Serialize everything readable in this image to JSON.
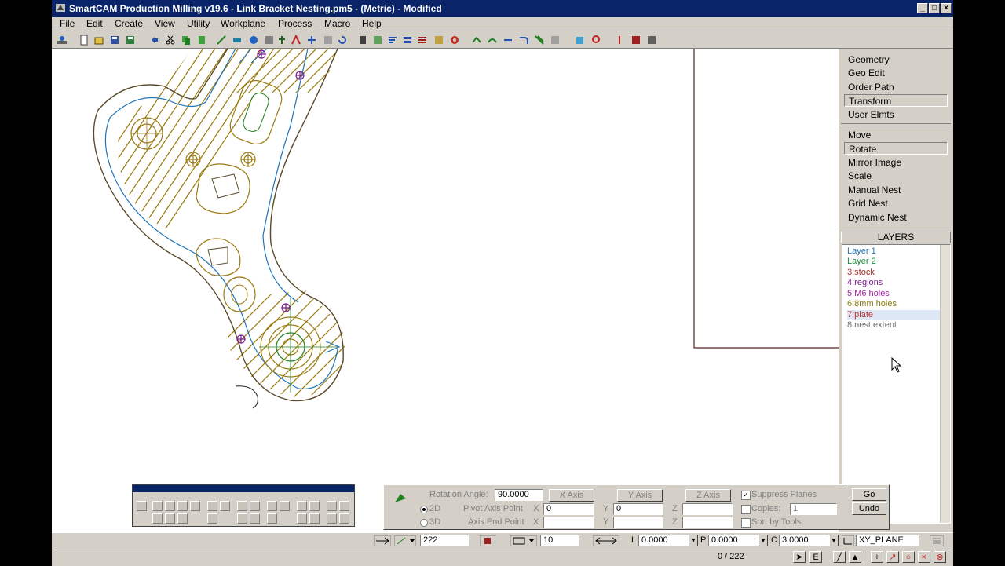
{
  "window": {
    "title": "SmartCAM Production Milling v19.6 - Link Bracket Nesting.pm5 - (Metric) - Modified",
    "controls": {
      "minimize": "_",
      "maximize": "□",
      "close": "×"
    }
  },
  "menu": [
    "File",
    "Edit",
    "Create",
    "View",
    "Utility",
    "Workplane",
    "Process",
    "Macro",
    "Help"
  ],
  "function_menu": {
    "groups": [
      [
        "Geometry",
        "Geo Edit",
        "Order Path",
        "Transform",
        "User Elmts"
      ],
      [
        "Move",
        "Rotate",
        "Mirror Image",
        "Scale",
        "Manual Nest",
        "Grid Nest",
        "Dynamic Nest"
      ]
    ],
    "selected_group_item": "Transform",
    "selected_sub_item": "Rotate"
  },
  "layers": {
    "header": "LAYERS",
    "items": [
      {
        "label": "Layer    1",
        "color": "#1f74b8"
      },
      {
        "label": "Layer    2",
        "color": "#1e8a3c"
      },
      {
        "label": "3:stock",
        "color": "#a0302a"
      },
      {
        "label": "4:regions",
        "color": "#7a1e8c"
      },
      {
        "label": "5:M6 holes",
        "color": "#a020a0"
      },
      {
        "label": "6:8mm holes",
        "color": "#8a7a10"
      },
      {
        "label": "7:plate",
        "color": "#c03030"
      },
      {
        "label": "8:nest extent",
        "color": "#707070"
      }
    ],
    "selected": "7:plate"
  },
  "rotate_panel": {
    "rotation_angle_label": "Rotation Angle:",
    "rotation_angle": "90.0000",
    "x_axis": "X Axis",
    "y_axis": "Y Axis",
    "z_axis": "Z Axis",
    "suppress_planes": "Suppress Planes",
    "suppress_planes_checked": true,
    "go": "Go",
    "undo": "Undo",
    "mode_2d": "2D",
    "mode_3d": "3D",
    "mode_selected": "2D",
    "pivot_label": "Pivot Axis Point",
    "end_label": "Axis End Point",
    "x": "X",
    "y": "Y",
    "z": "Z",
    "pivot_x": "0",
    "pivot_y": "0",
    "copies_label": "Copies:",
    "copies": "1",
    "sort_by_tools": "Sort by Tools"
  },
  "status": {
    "element_number": "222",
    "step_value": "10",
    "l_label": "L",
    "l_value": "0.0000",
    "p_label": "P",
    "p_value": "0.0000",
    "c_label": "C",
    "c_value": "3.0000",
    "plane": "XY_PLANE",
    "counter": "0 / 222"
  }
}
